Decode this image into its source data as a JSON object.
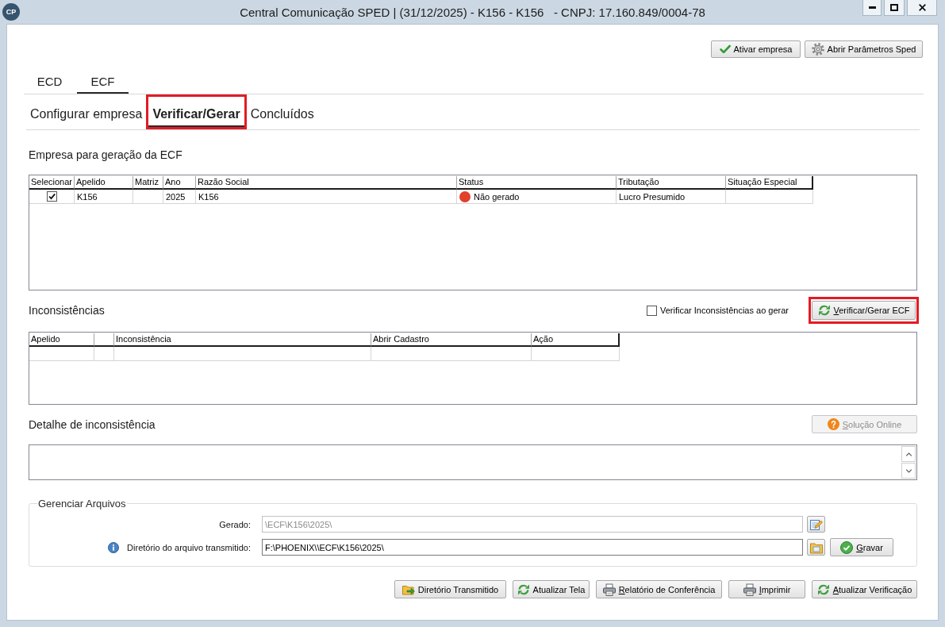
{
  "window": {
    "logo": "CP",
    "title": "Central Comunicação SPED | (31/12/2025) - K156 - K156   - CNPJ: 17.160.849/0004-78"
  },
  "toolbar": [
    {
      "label": "Ativar empresa",
      "kind": "activate",
      "mnemonic": false
    },
    {
      "label": "Abrir Parâmetros Sped",
      "kind": "parameters",
      "mnemonic": false
    }
  ],
  "tabs": [
    {
      "label": "ECD",
      "selected": false
    },
    {
      "label": "ECF",
      "selected": true
    }
  ],
  "subtabs": [
    {
      "label": "Configurar empresa",
      "selected": false,
      "highlighted": false
    },
    {
      "label": "Verificar/Gerar",
      "selected": true,
      "highlighted": true
    },
    {
      "label": "Concluídos",
      "selected": false,
      "highlighted": false
    }
  ],
  "companies": {
    "title": "Empresa para geração da ECF",
    "columns": [
      "Selecionar",
      "Apelido",
      "Matriz",
      "Ano",
      "Razão Social",
      "Status",
      "Tributação",
      "Situação Especial"
    ],
    "rows": [
      {
        "checked": true,
        "apelido": "K156",
        "ano": "2025",
        "razao_social": "K156",
        "status": {
          "label": "Não gerado",
          "color": "#e0402c"
        },
        "tributacao": "Lucro Presumido"
      }
    ]
  },
  "inconsistencies": {
    "title": "Inconsistências",
    "verify_on_generate": {
      "label": "Verificar Inconsistências ao gerar",
      "checked": false
    },
    "generate_button": {
      "label": "Verificar/Gerar ECF",
      "kind": "verify",
      "mnemonic": true,
      "highlighted": true
    },
    "columns": [
      "Apelido",
      "Inconsistência",
      "Abrir Cadastro",
      "Ação"
    ]
  },
  "detail": {
    "title": "Detalhe de inconsistência",
    "solution_button": {
      "label": "Solução Online",
      "kind": "solution",
      "mnemonic": true,
      "disabled": true
    }
  },
  "files": {
    "title": "Gerenciar Arquivos",
    "fields": [
      {
        "kind": "generated",
        "label": "Gerado:",
        "value": "\\ECF\\K156\\2025\\",
        "disabled": true
      },
      {
        "kind": "transmitted",
        "label": "Diretório do arquivo transmitido:",
        "value": "F:\\PHOENIX\\\\ECF\\K156\\2025\\",
        "disabled": false
      }
    ],
    "save_button": {
      "label": "Gravar",
      "kind": "save",
      "mnemonic": true
    }
  },
  "actions": [
    {
      "label": "Diretório Transmitido",
      "kind": "directory",
      "mnemonic": false
    },
    {
      "label": "Atualizar Tela",
      "kind": "refresh",
      "mnemonic": false
    },
    {
      "label": "Relatório de Conferência",
      "kind": "report",
      "mnemonic": true
    },
    {
      "label": "Imprimir",
      "kind": "print",
      "mnemonic": true
    },
    {
      "label": "Atualizar Verificação",
      "kind": "refresh",
      "mnemonic": true
    }
  ]
}
